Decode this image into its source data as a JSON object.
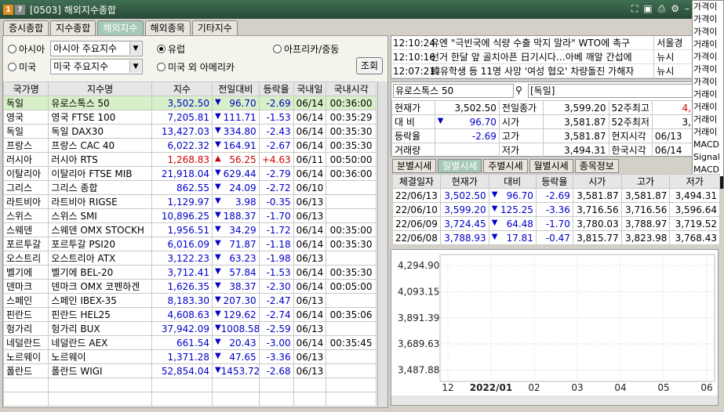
{
  "window": {
    "badge1": "1",
    "badge2": "?",
    "title": "[0503] 해외지수종합"
  },
  "tabs": [
    "증시종합",
    "지수종합",
    "해외지수",
    "해외종목",
    "기타지수"
  ],
  "filters": {
    "asia": "아시아",
    "asia_select": "아시아 주요지수",
    "europe": "유럽",
    "africa": "아프리카/중동",
    "usa": "미국",
    "usa_select": "미국 주요지수",
    "other_america": "미국 외 아메리카",
    "query_button": "조회"
  },
  "table": {
    "headers": [
      "국가명",
      "지수명",
      "지수",
      "전일대비",
      "등락율",
      "국내일",
      "국내시각"
    ],
    "rows": [
      [
        "독일",
        "유로스톡스 50",
        "3,502.50",
        "96.70",
        "-2.69",
        "06/14",
        "00:36:00",
        "dn"
      ],
      [
        "영국",
        "영국 FTSE 100",
        "7,205.81",
        "111.71",
        "-1.53",
        "06/14",
        "00:35:29",
        "dn"
      ],
      [
        "독일",
        "독일 DAX30",
        "13,427.03",
        "334.80",
        "-2.43",
        "06/14",
        "00:35:30",
        "dn"
      ],
      [
        "프랑스",
        "프랑스 CAC 40",
        "6,022.32",
        "164.91",
        "-2.67",
        "06/14",
        "00:35:30",
        "dn"
      ],
      [
        "러시아",
        "러시아 RTS",
        "1,268.83",
        "56.25",
        "+4.63",
        "06/11",
        "00:50:00",
        "up"
      ],
      [
        "이탈리아",
        "이탈리아 FTSE MIB",
        "21,918.04",
        "629.44",
        "-2.79",
        "06/14",
        "00:36:00",
        "dn"
      ],
      [
        "그리스",
        "그리스 종합",
        "862.55",
        "24.09",
        "-2.72",
        "06/10",
        "",
        "dn"
      ],
      [
        "라트비아",
        "라트비아 RIGSE",
        "1,129.97",
        "3.98",
        "-0.35",
        "06/13",
        "",
        "dn"
      ],
      [
        "스위스",
        "스위스 SMI",
        "10,896.25",
        "188.37",
        "-1.70",
        "06/13",
        "",
        "dn"
      ],
      [
        "스웨덴",
        "스웨덴 OMX STOCKH",
        "1,956.51",
        "34.29",
        "-1.72",
        "06/14",
        "00:35:00",
        "dn"
      ],
      [
        "포르투갈",
        "포르투갈 PSI20",
        "6,016.09",
        "71.87",
        "-1.18",
        "06/14",
        "00:35:30",
        "dn"
      ],
      [
        "오스트리",
        "오스트리아 ATX",
        "3,122.23",
        "63.23",
        "-1.98",
        "06/13",
        "",
        "dn"
      ],
      [
        "벨기에",
        "벨기에 BEL-20",
        "3,712.41",
        "57.84",
        "-1.53",
        "06/14",
        "00:35:30",
        "dn"
      ],
      [
        "덴마크",
        "덴마크 OMX 코펜하겐",
        "1,626.35",
        "38.37",
        "-2.30",
        "06/14",
        "00:05:00",
        "dn"
      ],
      [
        "스페인",
        "스페인 IBEX-35",
        "8,183.30",
        "207.30",
        "-2.47",
        "06/13",
        "",
        "dn"
      ],
      [
        "핀란드",
        "핀란드 HEL25",
        "4,608.63",
        "129.62",
        "-2.74",
        "06/14",
        "00:35:06",
        "dn"
      ],
      [
        "헝가리",
        "헝가리 BUX",
        "37,942.09",
        "1008.58",
        "-2.59",
        "06/13",
        "",
        "dn"
      ],
      [
        "네덜란드",
        "네덜란드 AEX",
        "661.54",
        "20.43",
        "-3.00",
        "06/14",
        "00:35:45",
        "dn"
      ],
      [
        "노르웨이",
        "노르웨이",
        "1,371.28",
        "47.65",
        "-3.36",
        "06/13",
        "",
        "dn"
      ],
      [
        "폴란드",
        "폴란드 WIGI",
        "52,854.04",
        "1453.72",
        "-2.68",
        "06/13",
        "",
        "dn"
      ]
    ]
  },
  "news": [
    {
      "time": "12:10:24",
      "headline": "유엔 \"극빈국에 식량 수출 막지 말라\" WTO에 촉구",
      "source": "서울경"
    },
    {
      "time": "12:10:16",
      "headline": "선거 한달 앞 골치아픈 日기시다…아베 깨알 간섭에",
      "source": "뉴시"
    },
    {
      "time": "12:07:21",
      "headline": "韓유학생 등 11명 사망 '여성 협오' 차량돌진 가해자",
      "source": "뉴시"
    }
  ],
  "quote": {
    "search_value": "유로스톡스 50",
    "market_value": "[독일]",
    "labels": [
      "현재가",
      "대 비",
      "등락율",
      "거래량",
      "전일종가",
      "시가",
      "고가",
      "저가",
      "52주최고",
      "52주최저",
      "현지시각",
      "한국시각"
    ],
    "current": "3,502.50",
    "change": "96.70",
    "rate": "-2.69",
    "prev_close": "3,599.20",
    "open": "3,581.87",
    "high": "3,581.87",
    "low": "3,494.31",
    "w52_high": "4,",
    "w52_low": "3,",
    "local_time": "06/13",
    "kr_time": "06/14"
  },
  "subtabs": [
    "분별시세",
    "일별시세",
    "주별시세",
    "월별시세",
    "종목정보"
  ],
  "daily": {
    "headers": [
      "체결일자",
      "현재가",
      "대비",
      "등락율",
      "시가",
      "고가",
      "저가"
    ],
    "rows": [
      [
        "22/06/13",
        "3,502.50",
        "96.70",
        "-2.69",
        "3,581.87",
        "3,581.87",
        "3,494.31"
      ],
      [
        "22/06/10",
        "3,599.20",
        "125.25",
        "-3.36",
        "3,716.56",
        "3,716.56",
        "3,596.64"
      ],
      [
        "22/06/09",
        "3,724.45",
        "64.48",
        "-1.70",
        "3,780.03",
        "3,788.97",
        "3,719.52"
      ],
      [
        "22/06/08",
        "3,788.93",
        "17.81",
        "-0.47",
        "3,815.77",
        "3,823.98",
        "3,768.43"
      ]
    ]
  },
  "sidemenu": [
    "가격이",
    "가격이",
    "가격이",
    "거래이",
    "가격이",
    "가격이",
    "가격이",
    "거래이",
    "거래이",
    "거래이",
    "거래이",
    "MACD",
    "Signal",
    "MACD",
    "가격"
  ],
  "chart_data": {
    "type": "line",
    "y_ticks": [
      "4,294.90",
      "4,093.15",
      "3,891.39",
      "3,689.63",
      "3,487.88"
    ],
    "x_ticks": [
      "12",
      "2022/01",
      "02",
      "03",
      "04",
      "05",
      "06"
    ],
    "ylim": [
      3400,
      4380
    ]
  }
}
